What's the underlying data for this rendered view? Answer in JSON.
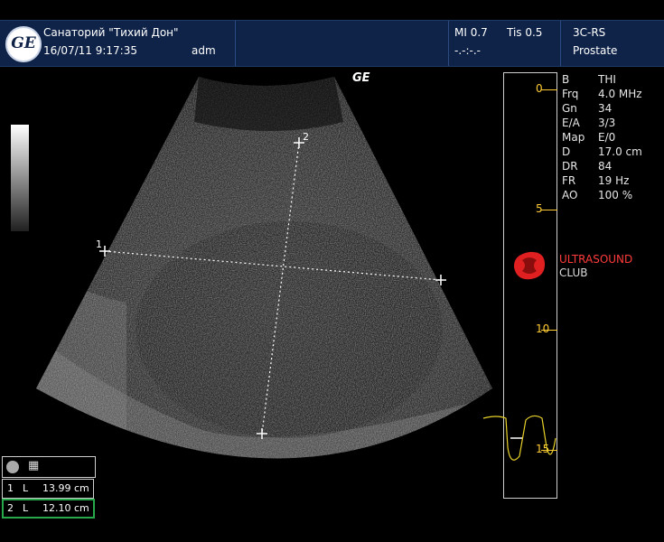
{
  "header": {
    "logo_text": "GE",
    "facility": "Санаторий \"Тихий Дон\"",
    "datetime": "16/07/11 9:17:35",
    "operator": "adm",
    "mi": "MI 0.7",
    "tis": "Tis 0.5",
    "tis_sub": "-.-:-.-",
    "probe": "3C-RS",
    "preset": "Prostate"
  },
  "image": {
    "ge_mark": "GE",
    "caliper_1": "1",
    "caliper_2": "2"
  },
  "params": [
    {
      "k": "B",
      "v": "THI"
    },
    {
      "k": "Frq",
      "v": "4.0 MHz"
    },
    {
      "k": "Gn",
      "v": "34"
    },
    {
      "k": "E/A",
      "v": "3/3"
    },
    {
      "k": "Map",
      "v": "E/0"
    },
    {
      "k": "D",
      "v": "17.0 cm"
    },
    {
      "k": "DR",
      "v": "84"
    },
    {
      "k": "FR",
      "v": "19 Hz"
    },
    {
      "k": "AO",
      "v": "100 %"
    }
  ],
  "depth_scale": [
    "0",
    "5",
    "10",
    "15"
  ],
  "watermark": {
    "line1": "ULTRASOUND",
    "line2": "CLUB"
  },
  "measurements": [
    {
      "index": "1",
      "type": "L",
      "value": "13.99 cm"
    },
    {
      "index": "2",
      "type": "L",
      "value": "12.10 cm"
    }
  ],
  "colors": {
    "header_bg": "#0f2247",
    "depth_scale": "#ffcc33",
    "active_measurement": "#27a84a",
    "watermark": "#ff3b3b"
  }
}
